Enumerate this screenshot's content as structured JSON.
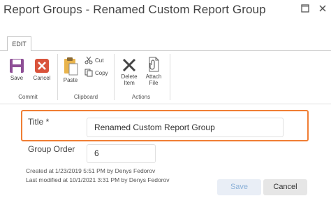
{
  "window": {
    "title": "Report Groups - Renamed Custom Report Group",
    "maximize_icon": "maximize-icon",
    "close_icon": "close-icon"
  },
  "ribbon": {
    "active_tab": "EDIT",
    "groups": {
      "commit": {
        "label": "Commit",
        "save_label": "Save",
        "cancel_label": "Cancel"
      },
      "clipboard": {
        "label": "Clipboard",
        "paste_label": "Paste",
        "cut_label": "Cut",
        "copy_label": "Copy"
      },
      "actions": {
        "label": "Actions",
        "delete_line1": "Delete",
        "delete_line2": "Item",
        "attach_line1": "Attach",
        "attach_line2": "File"
      }
    },
    "colors": {
      "save_icon": "#8e4f96",
      "cancel_icon": "#d9533b",
      "paste_icon": "#e9b44c",
      "highlight": "#f07e34"
    }
  },
  "form": {
    "title_label": "Title",
    "required_marker": "*",
    "title_value": "Renamed Custom Report Group",
    "group_order_label": "Group Order",
    "group_order_value": "6"
  },
  "meta": {
    "created": "Created at 1/23/2019 5:51 PM  by Denys Fedorov",
    "modified": "Last modified at 10/1/2021 3:31 PM  by Denys Fedorov"
  },
  "buttons": {
    "save": "Save",
    "cancel": "Cancel"
  }
}
